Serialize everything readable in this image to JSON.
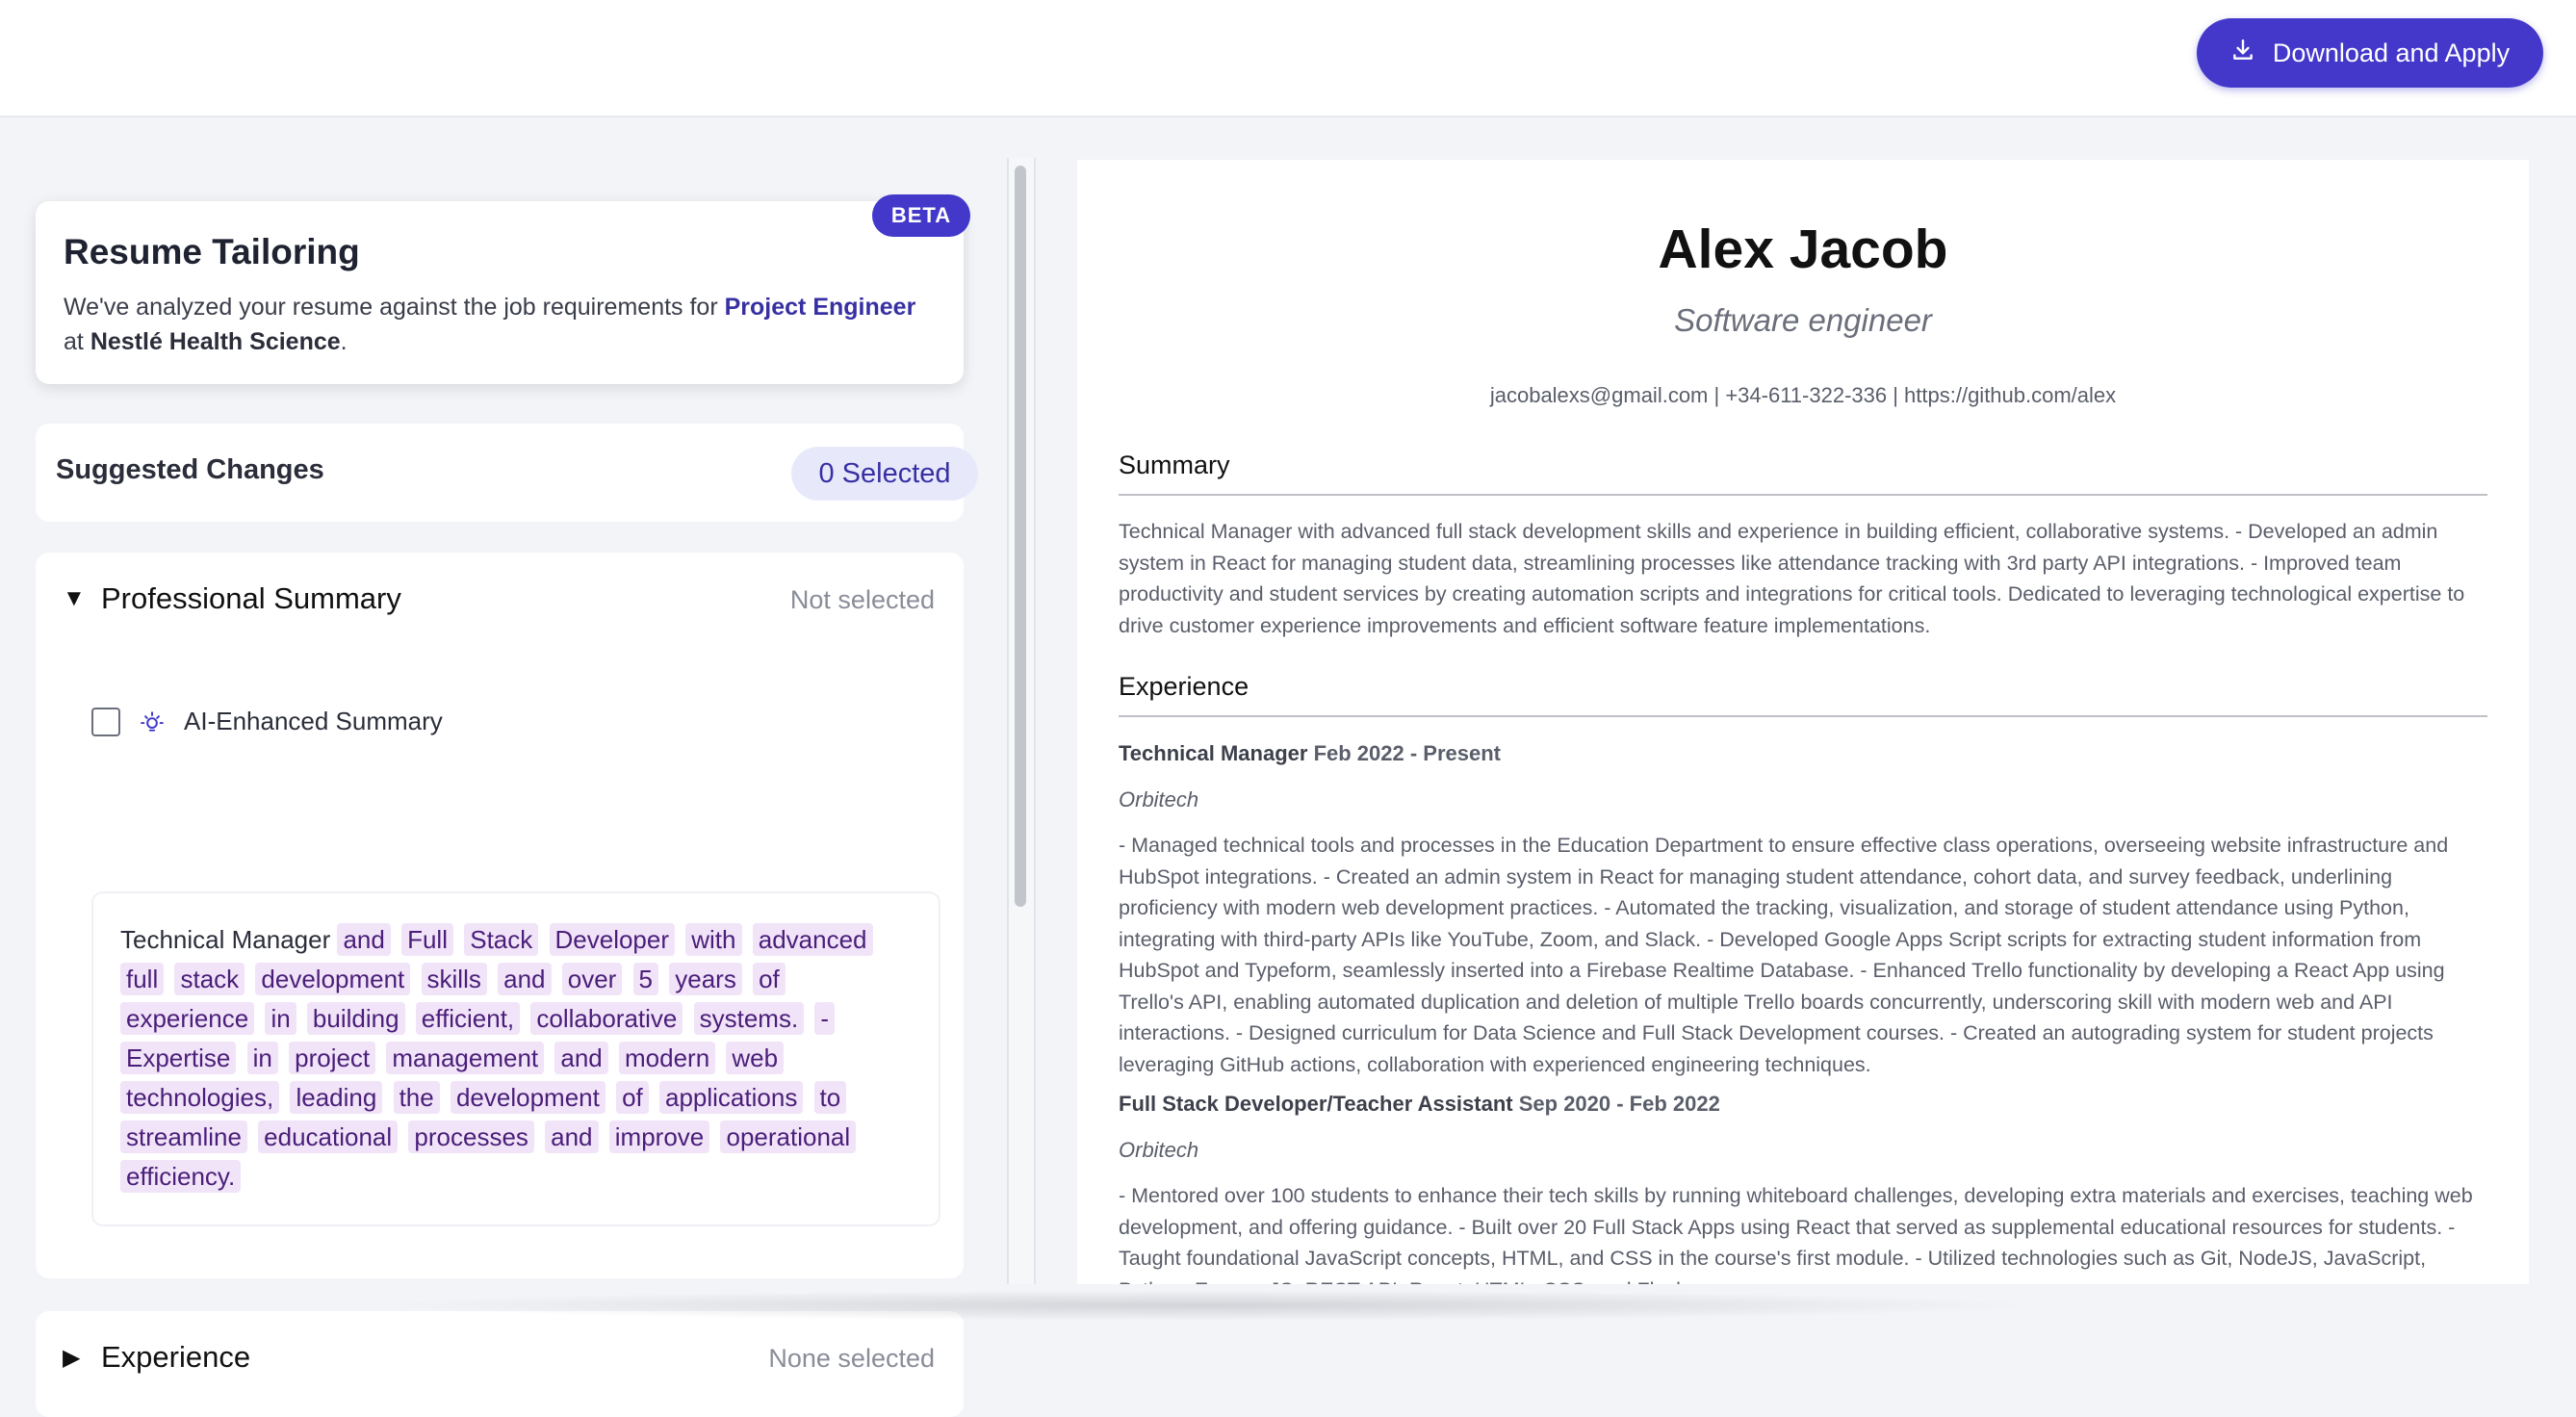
{
  "header": {
    "download_label": "Download and Apply",
    "download_icon": "download-icon"
  },
  "tailoring": {
    "badge": "BETA",
    "title": "Resume Tailoring",
    "intro": "We've analyzed your resume against the job requirements for",
    "role": "Project Engineer",
    "at": "at",
    "company": "Nestlé Health Science",
    "period": "."
  },
  "suggestions": {
    "title": "Suggested Changes",
    "selected_count": "0 Selected"
  },
  "professional_summary": {
    "title": "Professional Summary",
    "status": "Not selected",
    "toggle_icon": "triangle-down-icon",
    "option_label": "AI-Enhanced Summary",
    "option_icon": "lightbulb-icon",
    "checked": false,
    "prefix": "Technical Manager",
    "highlighted_words": [
      "and",
      "Full",
      "Stack",
      "Developer",
      "with",
      "advanced",
      "full",
      "stack",
      "development",
      "skills",
      "and",
      "over",
      "5",
      "years",
      "of",
      "experience",
      "in",
      "building",
      "efficient,",
      "collaborative",
      "systems.",
      "-",
      "Expertise",
      "in",
      "project",
      "management",
      "and",
      "modern",
      "web",
      "technologies,",
      "leading",
      "the",
      "development",
      "of",
      "applications",
      "to",
      "streamline",
      "educational",
      "processes",
      "and",
      "improve",
      "operational",
      "efficiency."
    ]
  },
  "experience_section": {
    "title": "Experience",
    "status": "None selected",
    "toggle_icon": "triangle-right-icon"
  },
  "resume": {
    "name": "Alex Jacob",
    "title": "Software engineer",
    "contact": "jacobalexs@gmail.com | +34-611-322-336 | https://github.com/alex",
    "summary_heading": "Summary",
    "summary_text": "Technical Manager with advanced full stack development skills and experience in building efficient, collaborative systems. - Developed an admin system in React for managing student data, streamlining processes like attendance tracking with 3rd party API integrations. - Improved team productivity and student services by creating automation scripts and integrations for critical tools. Dedicated to leveraging technological expertise to drive customer experience improvements and efficient software feature implementations.",
    "experience_heading": "Experience",
    "jobs": [
      {
        "title": "Technical Manager",
        "dates": "Feb 2022 - Present",
        "company": "Orbitech",
        "description": "- Managed technical tools and processes in the Education Department to ensure effective class operations, overseeing website infrastructure and HubSpot integrations. - Created an admin system in React for managing student attendance, cohort data, and survey feedback, underlining proficiency with modern web development practices. - Automated the tracking, visualization, and storage of student attendance using Python, integrating with third-party APIs like YouTube, Zoom, and Slack. - Developed Google Apps Script scripts for extracting student information from HubSpot and Typeform, seamlessly inserted into a Firebase Realtime Database. - Enhanced Trello functionality by developing a React App using Trello's API, enabling automated duplication and deletion of multiple Trello boards concurrently, underscoring skill with modern web and API interactions. - Designed curriculum for Data Science and Full Stack Development courses. - Created an autograding system for student projects leveraging GitHub actions, collaboration with experienced engineering techniques."
      },
      {
        "title": "Full Stack Developer/Teacher Assistant",
        "dates": "Sep 2020 - Feb 2022",
        "company": "Orbitech",
        "description": "- Mentored over 100 students to enhance their tech skills by running whiteboard challenges, developing extra materials and exercises, teaching web development, and offering guidance. - Built over 20 Full Stack Apps using React that served as supplemental educational resources for students. - Taught foundational JavaScript concepts, HTML, and CSS in the course's first module. - Utilized technologies such as Git, NodeJS, JavaScript, Python, ExpressJS, REST API, React, HTML, CSS, and Flask."
      }
    ]
  }
}
